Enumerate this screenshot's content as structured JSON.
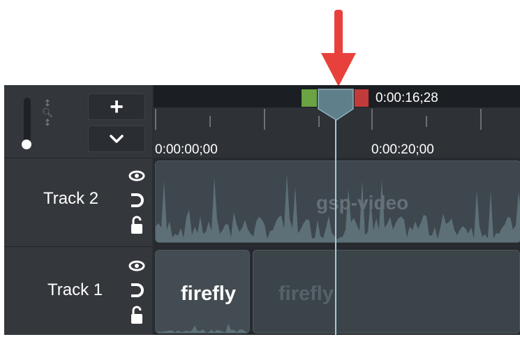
{
  "timeline": {
    "playhead_time": "0:00:16;28",
    "ruler_labels": [
      "0:00:00;00",
      "0:00:20;00"
    ],
    "zoom_icon": "magnifier-icon",
    "add_track_label": "+",
    "menu_icon": "chevron-down-icon"
  },
  "tracks": [
    {
      "name": "Track 2",
      "clips": [
        {
          "title": "gsp-video"
        }
      ]
    },
    {
      "name": "Track 1",
      "clips": [
        {
          "title": "firefly"
        },
        {
          "title": "firefly"
        }
      ]
    }
  ],
  "track_icons": [
    "eye-icon",
    "magnet-icon",
    "lock-icon"
  ],
  "colors": {
    "annotation_arrow": "#e8413c",
    "selection_start": "#6aa443",
    "selection_end": "#c23a3a",
    "playhead": "#5f7f8a"
  }
}
